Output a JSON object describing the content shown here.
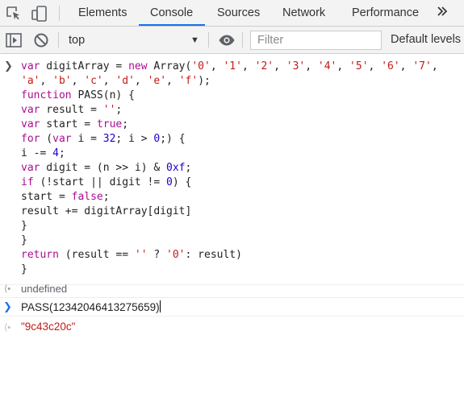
{
  "tabs": [
    {
      "label": "Elements"
    },
    {
      "label": "Console",
      "active": true
    },
    {
      "label": "Sources"
    },
    {
      "label": "Network"
    },
    {
      "label": "Performance"
    }
  ],
  "more_tabs_icon": "chevron-double-right",
  "toolbar": {
    "context_value": "top",
    "filter_placeholder": "Filter",
    "levels_label": "Default levels"
  },
  "console": {
    "code_lines": [
      "var digitArray = new Array('0', '1', '2', '3', '4', '5', '6', '7',",
      "'a', 'b', 'c', 'd', 'e', 'f');",
      "function PASS(n) {",
      "var result = '';",
      "var start = true;",
      "for (var i = 32; i > 0;) {",
      "i -= 4;",
      "var digit = (n >> i) & 0xf;",
      "if (!start || digit != 0) {",
      "start = false;",
      "result += digitArray[digit]",
      "}",
      "}",
      "return (result == '' ? '0': result)",
      "}"
    ],
    "result_1": "undefined",
    "command": "PASS(12342046413275659)",
    "output": "\"9c43c20c\""
  },
  "colors": {
    "keyword": "#aa0d91",
    "string": "#c41a16",
    "number": "#1c00cf",
    "accent": "#1a73e8"
  }
}
